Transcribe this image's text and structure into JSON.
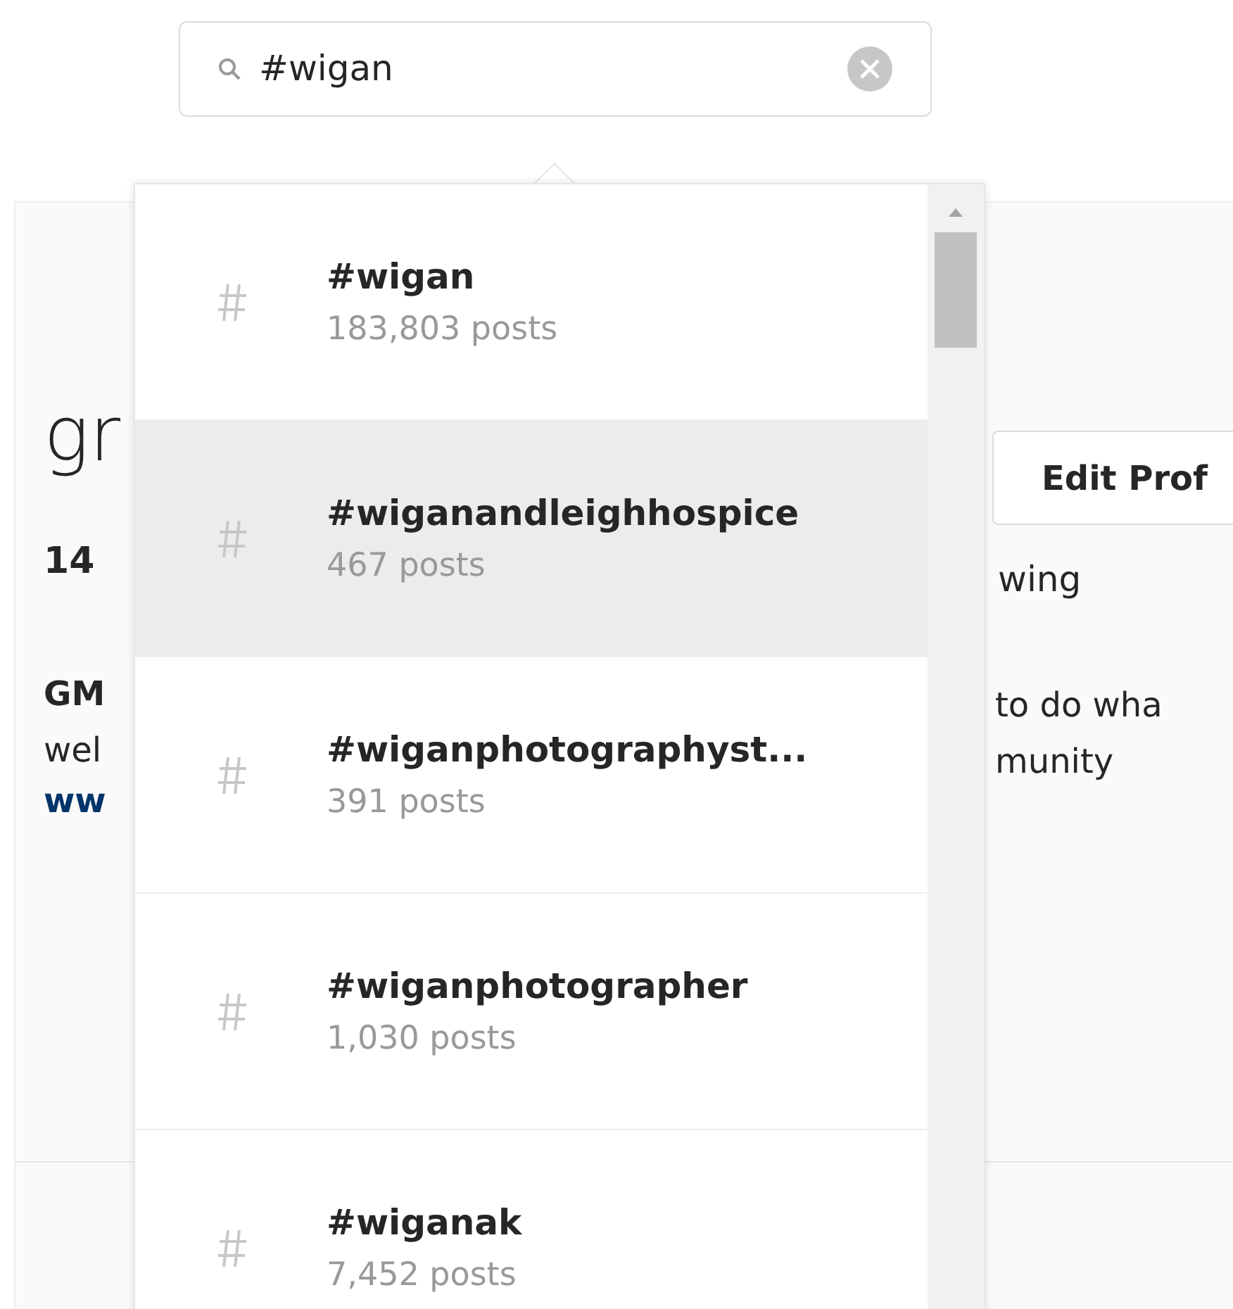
{
  "search": {
    "value": "#wigan"
  },
  "profile": {
    "username": "gr",
    "posts": "14",
    "bio_lines": [
      "GM",
      "wel"
    ],
    "link": "ww",
    "edit_button": "Edit Prof",
    "following": "wing",
    "bio_right_lines": [
      "to do wha",
      "munity"
    ]
  },
  "results": [
    {
      "tag": "#wigan",
      "count": "183,803 posts",
      "selected": false
    },
    {
      "tag": "#wiganandleighhospice",
      "count": "467 posts",
      "selected": true
    },
    {
      "tag": "#wiganphotographyst...",
      "count": "391 posts",
      "selected": false
    },
    {
      "tag": "#wiganphotographer",
      "count": "1,030 posts",
      "selected": false
    },
    {
      "tag": "#wiganak",
      "count": "7,452 posts",
      "selected": false
    }
  ]
}
